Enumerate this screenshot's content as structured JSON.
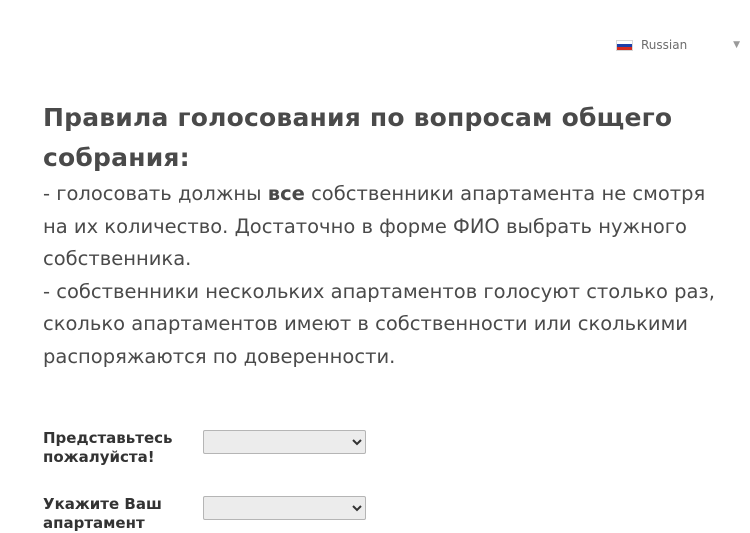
{
  "language": {
    "selected": "Russian",
    "flag_colors": [
      "#ffffff",
      "#1c3fa8",
      "#d52b1e"
    ]
  },
  "heading": "Правила голосования по вопросам общего собрания:",
  "rules": [
    {
      "prefix": "- голосовать должны ",
      "bold": "все",
      "suffix": " собственники апартамента не смотря на их количество. Достаточно в форме ФИО выбрать нужного собственника."
    },
    {
      "text": "- собственники нескольких апартаментов голосуют столько раз, сколько апартаментов имеют в собственности или сколькими распоряжаются по доверенности."
    }
  ],
  "form": {
    "name_label": "Представьтесь пожалуйста!",
    "name_value": "",
    "apartment_label": "Укажите Ваш апартамент",
    "apartment_value": ""
  }
}
